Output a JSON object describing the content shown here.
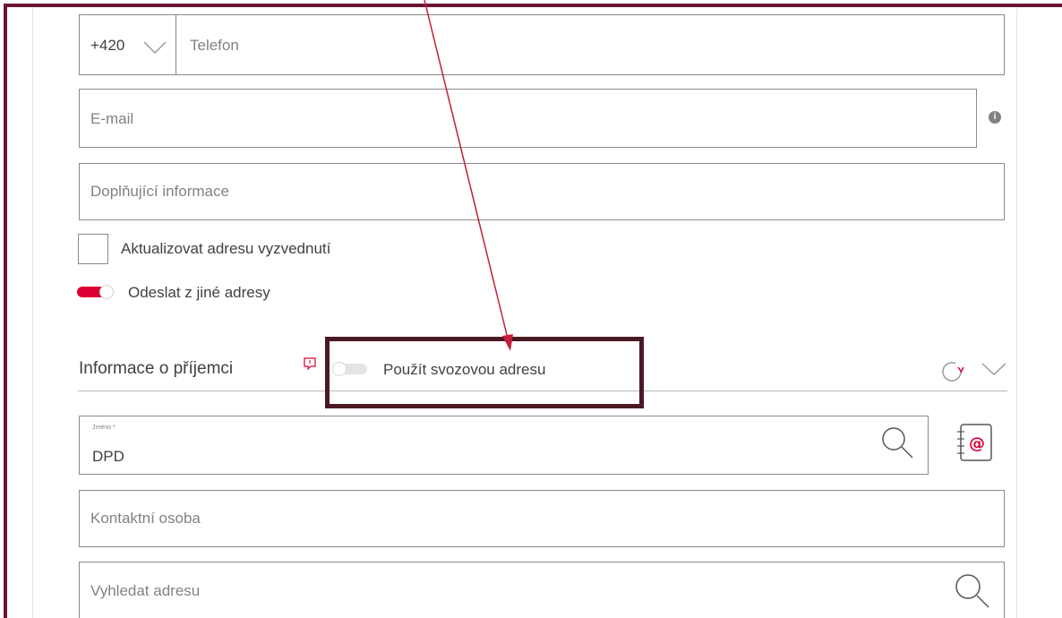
{
  "phone": {
    "prefix": "+420",
    "placeholder": "Telefon"
  },
  "email": {
    "placeholder": "E-mail",
    "info_icon": "i"
  },
  "additional_info": {
    "placeholder": "Doplňující informace"
  },
  "update_pickup": {
    "label": "Aktualizovat adresu vyzvednutí",
    "checked": false
  },
  "send_other_address": {
    "label": "Odeslat z jiné adresy",
    "on": true
  },
  "recipient": {
    "title": "Informace o příjemci",
    "use_pickup_toggle": {
      "label": "Použít svozovou adresu",
      "on": false
    },
    "name_field": {
      "label": "Jméno *",
      "value": "DPD"
    },
    "contact_person": {
      "placeholder": "Kontaktní osoba"
    },
    "search_address": {
      "placeholder": "Vyhledat adresu"
    }
  },
  "colors": {
    "accent": "#dc0032",
    "annotation": "#6b1434",
    "highlight": "#4a1a22"
  }
}
